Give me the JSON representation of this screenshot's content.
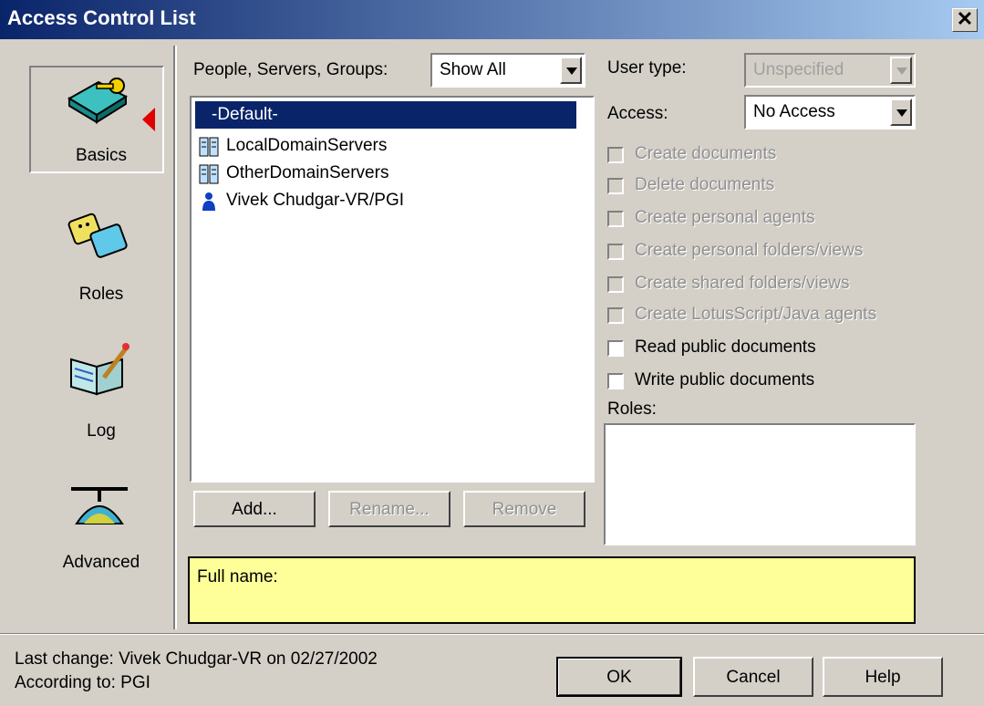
{
  "window": {
    "title": "Access Control List",
    "close_label": "✕"
  },
  "nav": {
    "items": [
      {
        "label": "Basics",
        "icon": "key-book-icon",
        "selected": true
      },
      {
        "label": "Roles",
        "icon": "roles-icon"
      },
      {
        "label": "Log",
        "icon": "log-icon"
      },
      {
        "label": "Advanced",
        "icon": "advanced-icon"
      }
    ]
  },
  "people": {
    "filter_label": "People, Servers, Groups:",
    "filter_value": "Show All",
    "entries": [
      {
        "label": "-Default-",
        "type": "default",
        "selected": true
      },
      {
        "label": "LocalDomainServers",
        "type": "server-group"
      },
      {
        "label": "OtherDomainServers",
        "type": "server-group"
      },
      {
        "label": "Vivek Chudgar-VR/PGI",
        "type": "person"
      }
    ]
  },
  "buttons": {
    "add": "Add...",
    "rename": "Rename...",
    "remove": "Remove",
    "ok": "OK",
    "cancel": "Cancel",
    "help": "Help"
  },
  "user_type": {
    "label": "User type:",
    "value": "Unspecified"
  },
  "access": {
    "label": "Access:",
    "value": "No Access"
  },
  "permissions": [
    {
      "label": "Create documents",
      "checked": false,
      "enabled": false
    },
    {
      "label": "Delete documents",
      "checked": false,
      "enabled": false
    },
    {
      "label": "Create personal agents",
      "checked": false,
      "enabled": false
    },
    {
      "label": "Create personal folders/views",
      "checked": false,
      "enabled": false
    },
    {
      "label": "Create shared folders/views",
      "checked": false,
      "enabled": false
    },
    {
      "label": "Create LotusScript/Java agents",
      "checked": false,
      "enabled": false
    },
    {
      "label": "Read public documents",
      "checked": false,
      "enabled": true
    },
    {
      "label": "Write public documents",
      "checked": false,
      "enabled": true
    }
  ],
  "roles_label": "Roles:",
  "fullname_label": "Full name:",
  "footer": {
    "last_change": "Last change: Vivek Chudgar-VR on 02/27/2002",
    "according_to": "According to: PGI"
  },
  "colors": {
    "title_start": "#0a246a",
    "title_end": "#a6caf0",
    "face": "#d4d0c8",
    "selection": "#0a246a",
    "note": "#ffff99",
    "arrow": "#e00000"
  }
}
